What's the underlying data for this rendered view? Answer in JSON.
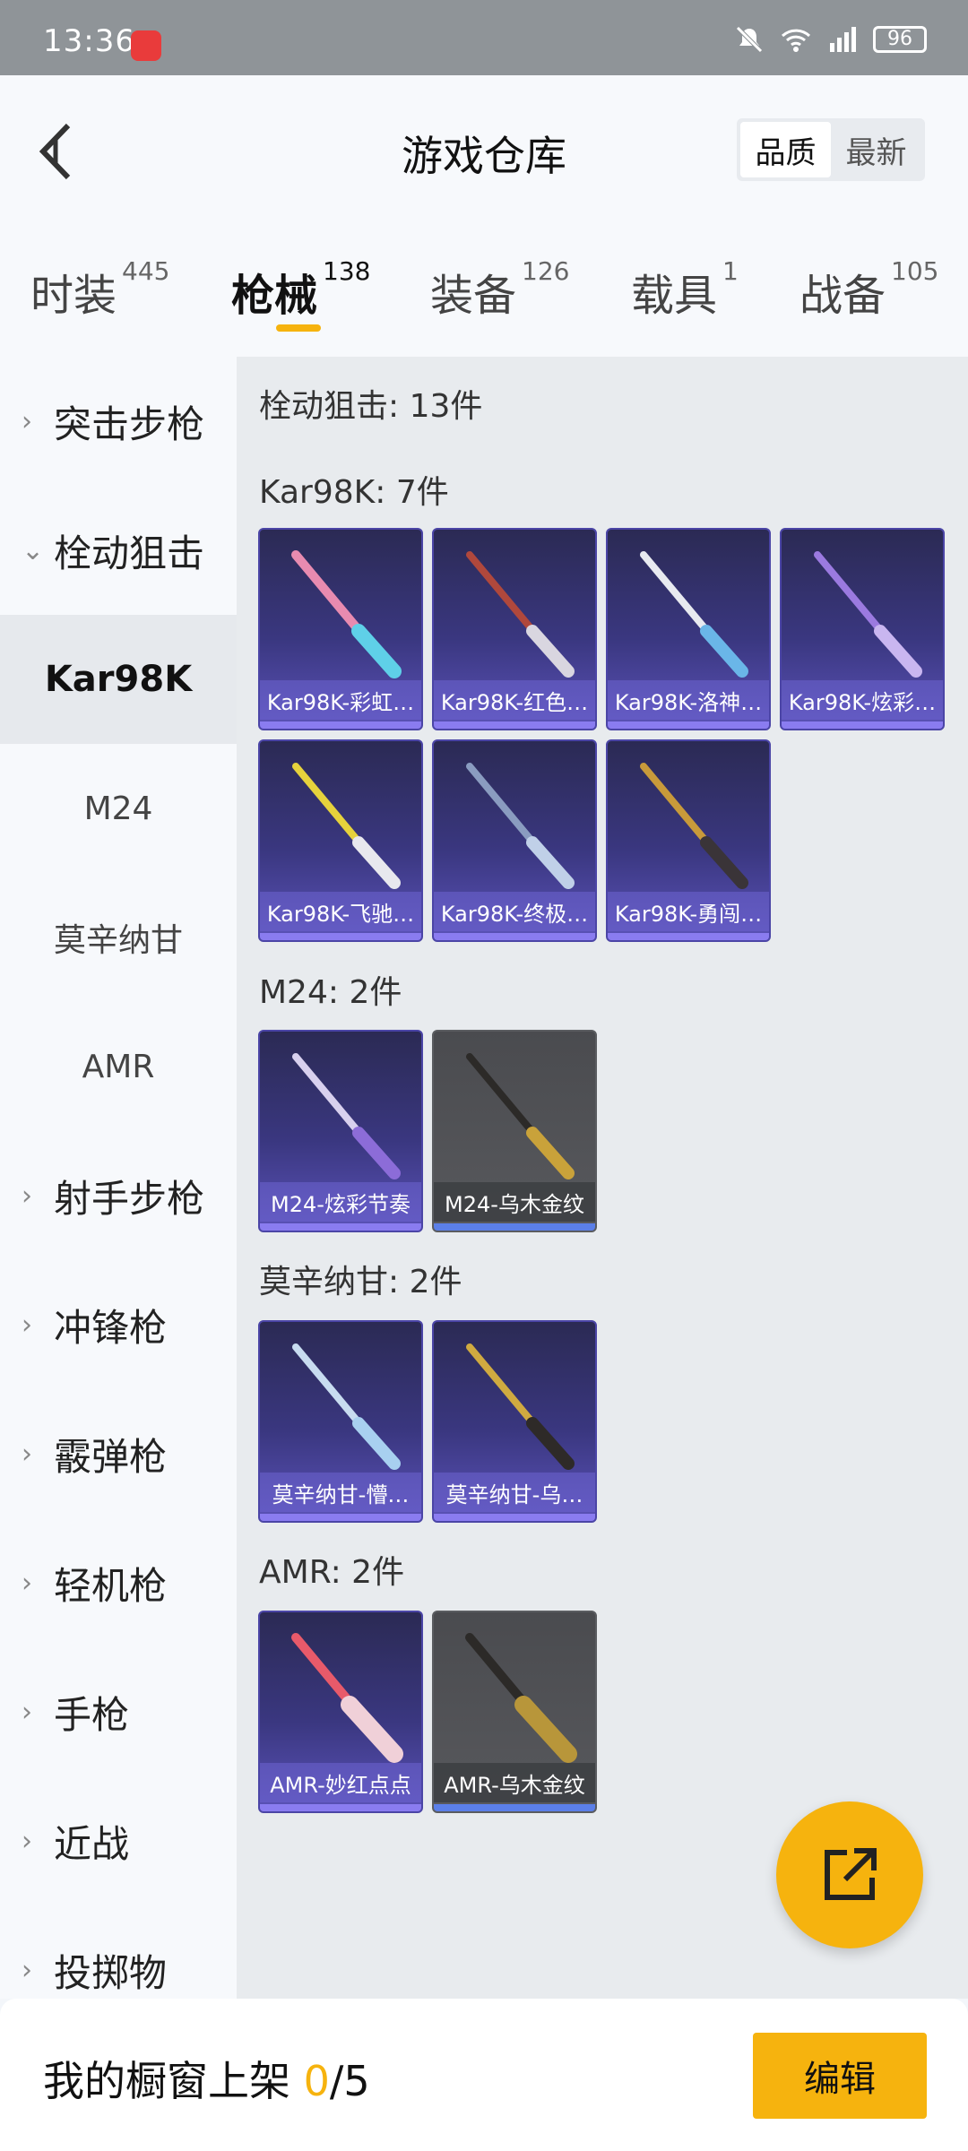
{
  "status_bar": {
    "time": "13:36",
    "battery": "96"
  },
  "header": {
    "title": "游戏仓库",
    "sort_quality": "品质",
    "sort_newest": "最新"
  },
  "tabs": [
    {
      "label": "时装",
      "count": "445"
    },
    {
      "label": "枪械",
      "count": "138"
    },
    {
      "label": "装备",
      "count": "126"
    },
    {
      "label": "载具",
      "count": "1"
    },
    {
      "label": "战备",
      "count": "105"
    }
  ],
  "sidebar": {
    "items": [
      "突击步枪",
      "栓动狙击",
      "Kar98K",
      "M24",
      "莫辛纳甘",
      "AMR",
      "射手步枪",
      "冲锋枪",
      "霰弹枪",
      "轻机枪",
      "手枪",
      "近战",
      "投掷物"
    ]
  },
  "content": {
    "category_title": "栓动狙击: 13件",
    "groups": [
      {
        "title": "Kar98K: 7件",
        "items": [
          "Kar98K-彩虹…",
          "Kar98K-红色…",
          "Kar98K-洛神…",
          "Kar98K-炫彩…",
          "Kar98K-飞驰…",
          "Kar98K-终极…",
          "Kar98K-勇闯…"
        ]
      },
      {
        "title": "M24: 2件",
        "items": [
          "M24-炫彩节奏",
          "M24-乌木金纹"
        ]
      },
      {
        "title": "莫辛纳甘: 2件",
        "items": [
          "莫辛纳甘-懵…",
          "莫辛纳甘-乌…"
        ]
      },
      {
        "title": "AMR: 2件",
        "items": [
          "AMR-妙红点点",
          "AMR-乌木金纹"
        ]
      }
    ]
  },
  "bottom": {
    "showcase_label": "我的橱窗上架 ",
    "showcase_current": "0",
    "showcase_total": "/5",
    "edit_label": "编辑"
  },
  "colors": {
    "accent": "#f6b30e",
    "card_purple": "#3a3780",
    "card_gray": "#58595d"
  }
}
